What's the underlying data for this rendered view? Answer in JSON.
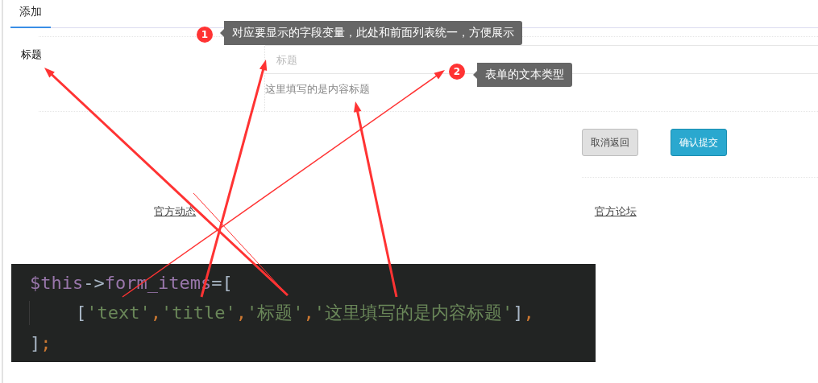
{
  "tabs": [
    {
      "label": "添加",
      "selected": true
    }
  ],
  "form": {
    "fields": [
      {
        "label": "标题",
        "placeholder": "标题",
        "help": "这里填写的是内容标题"
      }
    ],
    "buttons": [
      {
        "label": "取消返回",
        "kind": "default"
      },
      {
        "label": "确认提交",
        "kind": "primary"
      }
    ]
  },
  "footer_links": [
    "官方动态",
    "官方论坛"
  ],
  "code": {
    "lines": [
      {
        "indented": false,
        "tokens": [
          {
            "kind": "variable",
            "text": "$this"
          },
          {
            "kind": "operator",
            "text": "->"
          },
          {
            "kind": "variable",
            "text": "form_items"
          },
          {
            "kind": "operator",
            "text": "="
          },
          {
            "kind": "bracket",
            "text": "["
          }
        ]
      },
      {
        "indented": true,
        "tokens": [
          {
            "kind": "bracket",
            "text": "["
          },
          {
            "kind": "string",
            "text": "'text'"
          },
          {
            "kind": "comma",
            "text": ","
          },
          {
            "kind": "string",
            "text": "'title'"
          },
          {
            "kind": "comma",
            "text": ","
          },
          {
            "kind": "string",
            "text": "'标题'"
          },
          {
            "kind": "comma",
            "text": ","
          },
          {
            "kind": "string",
            "text": "'这里填写的是内容标题'"
          },
          {
            "kind": "bracket",
            "text": "]"
          },
          {
            "kind": "comma",
            "text": ","
          }
        ]
      },
      {
        "indented": false,
        "tokens": [
          {
            "kind": "bracket",
            "text": "]"
          },
          {
            "kind": "comma",
            "text": ";"
          }
        ]
      }
    ]
  },
  "annotations": [
    {
      "number": "1",
      "text": "对应要显示的字段变量，此处和前面列表统一，方便展示"
    },
    {
      "number": "2",
      "text": "表单的文本类型"
    }
  ]
}
